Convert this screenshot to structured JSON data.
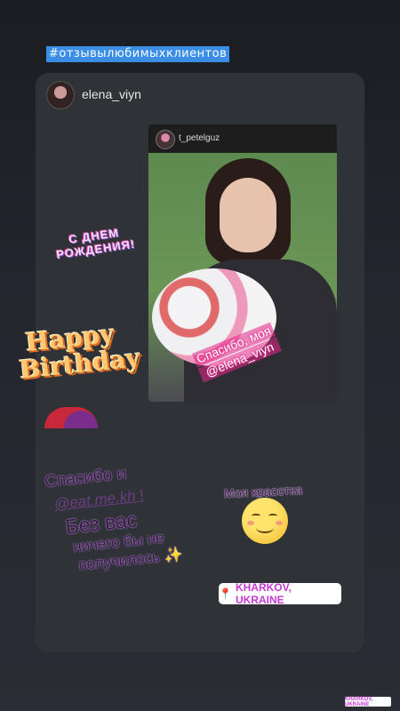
{
  "hashtag": "#отзывылюбимыхклиентов",
  "author": {
    "username": "elena_viyn"
  },
  "post": {
    "username": "t_petelguz",
    "caption_line1": "Спасибо, моя",
    "caption_line2": "@elena_viyn"
  },
  "stickers": {
    "dnem_line1": "С ДНЕМ",
    "dnem_line2": "РОЖДЕНИЯ!",
    "happy": "Happy",
    "birthday": "Birthday"
  },
  "text": {
    "thanks_line1": "Спасибо и",
    "thanks_mention": "@eat.me.kh",
    "thanks_excl": "!",
    "line3": "Без вас",
    "line4": "ничего бы не",
    "line5": "получилось",
    "sparkle": "✨",
    "beauty": "Моя красотка"
  },
  "location": {
    "label": "KHARKOV, UKRAINE",
    "pin": "📍"
  },
  "mini_location": "KHARKOV, UKRAINE",
  "colors": {
    "hashtag_bg": "#3a8ee6",
    "location_text": "#c53ad2",
    "card_bg": "#2f3237"
  }
}
